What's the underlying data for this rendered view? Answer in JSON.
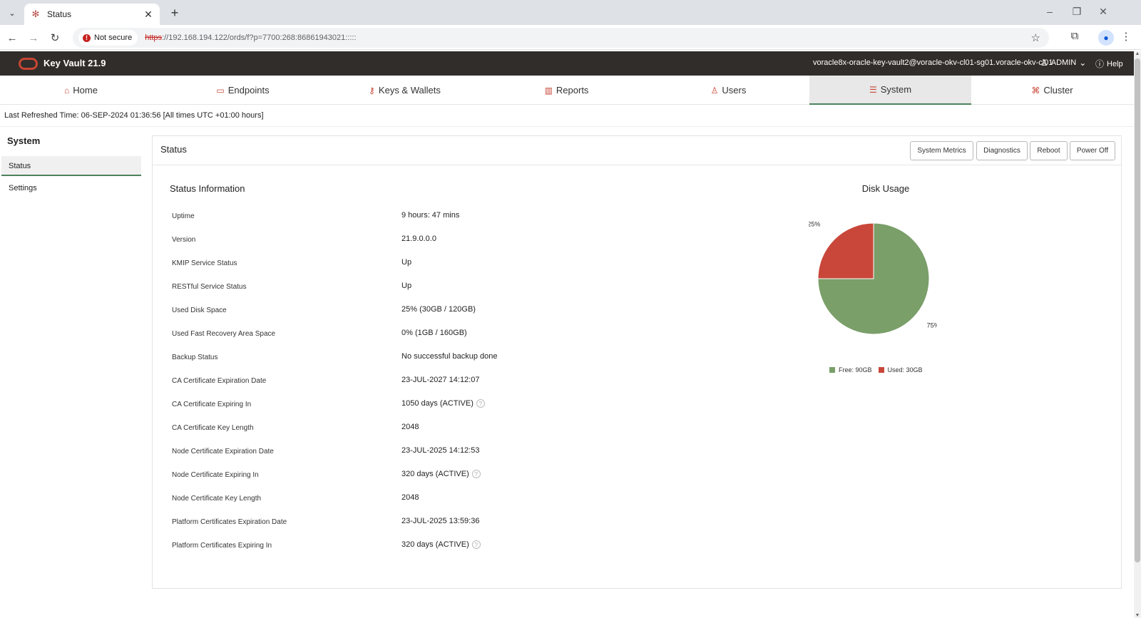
{
  "browser": {
    "tab_title": "Status",
    "close_glyph": "✕",
    "new_tab_glyph": "+",
    "not_secure": "Not secure",
    "url_scheme": "https",
    "url_rest": "://192.168.194.122/ords/f?p=7700:268:86861943021:::::"
  },
  "app": {
    "title": "Key Vault 21.9",
    "user_string": "voracle8x-oracle-key-vault2@voracle-okv-cl01-sg01.voracle-okv-cl01",
    "admin_label": "ADMIN",
    "help_label": "Help"
  },
  "nav": {
    "items": [
      {
        "label": "Home",
        "icon": "home-icon"
      },
      {
        "label": "Endpoints",
        "icon": "monitor-icon"
      },
      {
        "label": "Keys & Wallets",
        "icon": "key-icon"
      },
      {
        "label": "Reports",
        "icon": "bar-chart-icon"
      },
      {
        "label": "Users",
        "icon": "user-icon"
      },
      {
        "label": "System",
        "icon": "list-icon"
      },
      {
        "label": "Cluster",
        "icon": "network-icon"
      }
    ],
    "active": "System"
  },
  "refresh_text": "Last Refreshed Time: 06-SEP-2024 01:36:56 [All times UTC +01:00 hours]",
  "sidebar": {
    "title": "System",
    "items": [
      {
        "label": "Status"
      },
      {
        "label": "Settings"
      }
    ]
  },
  "panel": {
    "title": "Status",
    "buttons": {
      "metrics": "System Metrics",
      "diagnostics": "Diagnostics",
      "reboot": "Reboot",
      "power_off": "Power Off"
    },
    "info_title": "Status Information",
    "rows": [
      {
        "label": "Uptime",
        "value": "9 hours: 47 mins"
      },
      {
        "label": "Version",
        "value": "21.9.0.0.0"
      },
      {
        "label": "KMIP Service Status",
        "value": "Up"
      },
      {
        "label": "RESTful Service Status",
        "value": "Up"
      },
      {
        "label": "Used Disk Space",
        "value": "25% (30GB / 120GB)"
      },
      {
        "label": "Used Fast Recovery Area Space",
        "value": "0% (1GB / 160GB)"
      },
      {
        "label": "Backup Status",
        "value": "No successful backup done"
      },
      {
        "label": "CA Certificate Expiration Date",
        "value": "23-JUL-2027 14:12:07"
      },
      {
        "label": "CA Certificate Expiring In",
        "value": "1050 days (ACTIVE)"
      },
      {
        "label": "CA Certificate Key Length",
        "value": "2048"
      },
      {
        "label": "Node Certificate Expiration Date",
        "value": "23-JUL-2025 14:12:53"
      },
      {
        "label": "Node Certificate Expiring In",
        "value": "320 days (ACTIVE)"
      },
      {
        "label": "Node Certificate Key Length",
        "value": "2048"
      },
      {
        "label": "Platform Certificates Expiration Date",
        "value": "23-JUL-2025 13:59:36"
      },
      {
        "label": "Platform Certificates Expiring In",
        "value": "320 days (ACTIVE)"
      }
    ]
  },
  "chart_data": {
    "type": "pie",
    "title": "Disk Usage",
    "slices": [
      {
        "name": "Free: 90GB",
        "value": 75,
        "label": "75%",
        "color": "#7a9f69"
      },
      {
        "name": "Used: 30GB",
        "value": 25,
        "label": "25%",
        "color": "#c9473a"
      }
    ],
    "legend_position": "bottom"
  }
}
